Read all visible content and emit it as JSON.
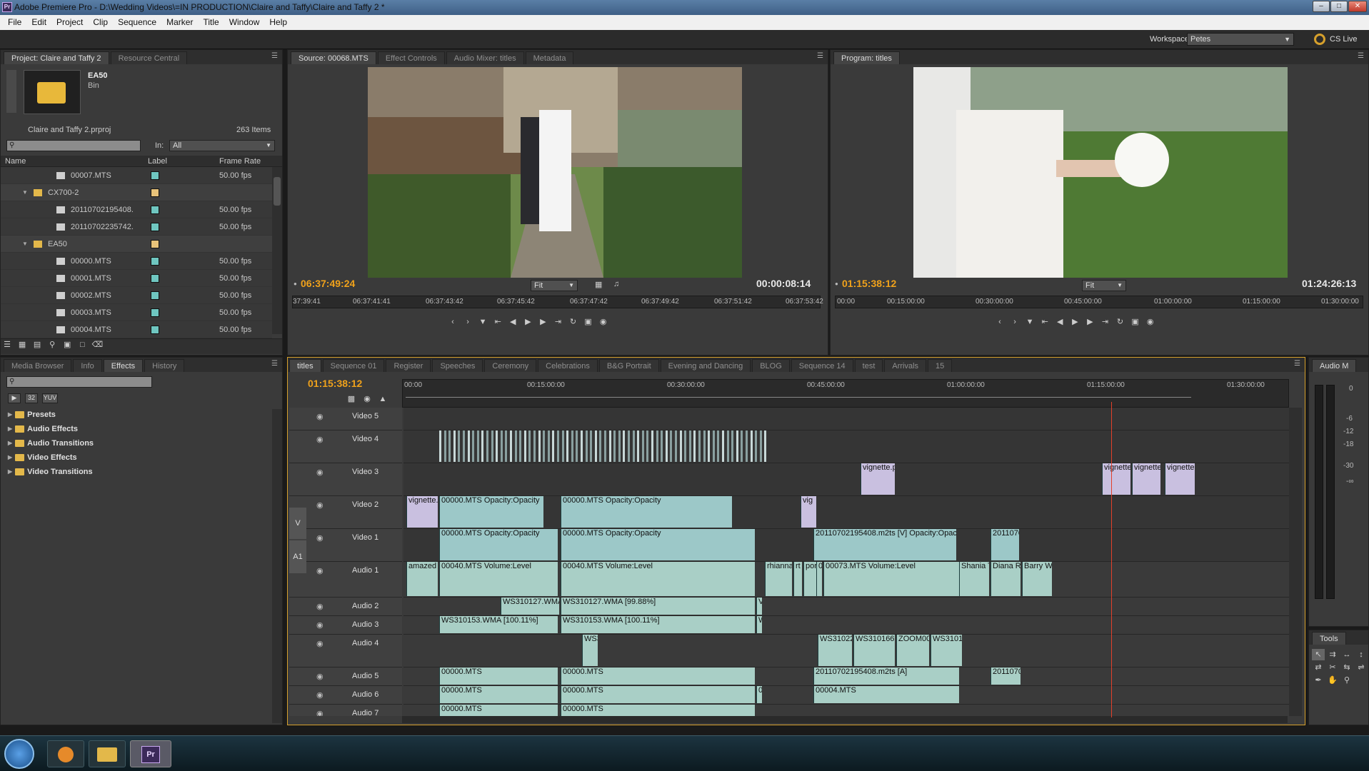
{
  "window": {
    "title": "Adobe Premiere Pro - D:\\Wedding Videos\\=IN PRODUCTION\\Claire and Taffy\\Claire and Taffy 2 *",
    "icon": "Pr"
  },
  "menu": [
    "File",
    "Edit",
    "Project",
    "Clip",
    "Sequence",
    "Marker",
    "Title",
    "Window",
    "Help"
  ],
  "workspace": {
    "label": "Workspace:",
    "value": "Petes",
    "cslive": "CS Live"
  },
  "project_panel": {
    "tabs": [
      "Project: Claire and Taffy 2",
      "Resource Central"
    ],
    "bin_name": "EA50",
    "bin_type": "Bin",
    "project_file": "Claire and Taffy 2.prproj",
    "item_count": "263 Items",
    "in_label": "In:",
    "in_value": "All",
    "columns": [
      "Name",
      "Label",
      "Frame Rate"
    ],
    "rows": [
      {
        "name": "00007.MTS",
        "rate": "50.00 fps",
        "type": "clip",
        "color": "#6fc6c0"
      },
      {
        "name": "CX700-2",
        "rate": "",
        "type": "bin",
        "color": "#e8c37a"
      },
      {
        "name": "20110702195408.",
        "rate": "50.00 fps",
        "type": "clip",
        "color": "#6fc6c0"
      },
      {
        "name": "20110702235742.",
        "rate": "50.00 fps",
        "type": "clip",
        "color": "#6fc6c0"
      },
      {
        "name": "EA50",
        "rate": "",
        "type": "bin",
        "color": "#e8c37a"
      },
      {
        "name": "00000.MTS",
        "rate": "50.00 fps",
        "type": "clip",
        "color": "#6fc6c0"
      },
      {
        "name": "00001.MTS",
        "rate": "50.00 fps",
        "type": "clip",
        "color": "#6fc6c0"
      },
      {
        "name": "00002.MTS",
        "rate": "50.00 fps",
        "type": "clip",
        "color": "#6fc6c0"
      },
      {
        "name": "00003.MTS",
        "rate": "50.00 fps",
        "type": "clip",
        "color": "#6fc6c0"
      },
      {
        "name": "00004.MTS",
        "rate": "50.00 fps",
        "type": "clip",
        "color": "#6fc6c0"
      }
    ]
  },
  "source_monitor": {
    "tabs": [
      "Source: 00068.MTS",
      "Effect Controls",
      "Audio Mixer: titles",
      "Metadata"
    ],
    "timecode_in": "06:37:49:24",
    "duration": "00:00:08:14",
    "fit": "Fit",
    "ruler": [
      "37:39:41",
      "06:37:41:41",
      "06:37:43:42",
      "06:37:45:42",
      "06:37:47:42",
      "06:37:49:42",
      "06:37:51:42",
      "06:37:53:42"
    ]
  },
  "program_monitor": {
    "tabs": [
      "Program: titles"
    ],
    "timecode_in": "01:15:38:12",
    "duration": "01:24:26:13",
    "fit": "Fit",
    "ruler": [
      "00:00",
      "00:15:00:00",
      "00:30:00:00",
      "00:45:00:00",
      "01:00:00:00",
      "01:15:00:00",
      "01:30:00:00"
    ]
  },
  "effects_panel": {
    "tabs": [
      "Media Browser",
      "Info",
      "Effects",
      "History"
    ],
    "buttons": [
      "32",
      "YUV"
    ],
    "folders": [
      "Presets",
      "Audio Effects",
      "Audio Transitions",
      "Video Effects",
      "Video Transitions"
    ]
  },
  "timeline": {
    "tabs": [
      "titles",
      "Sequence 01",
      "Register",
      "Speeches",
      "Ceremony",
      "Celebrations",
      "B&G Portrait",
      "Evening and Dancing",
      "BLOG",
      "Sequence 14",
      "test",
      "Arrivals",
      "15"
    ],
    "timecode": "01:15:38:12",
    "ruler": [
      "00:00",
      "00:15:00:00",
      "00:30:00:00",
      "00:45:00:00",
      "01:00:00:00",
      "01:15:00:00",
      "01:30:00:00"
    ],
    "tracks": [
      "Video 5",
      "Video 4",
      "Video 3",
      "Video 2",
      "Video 1",
      "Audio 1",
      "Audio 2",
      "Audio 3",
      "Audio 4",
      "Audio 5",
      "Audio 6",
      "Audio 7"
    ],
    "v_label": "V",
    "a_label": "A1",
    "clips": {
      "v3": [
        "vignette.ps",
        "vignette.",
        "vignette.",
        "vignette."
      ],
      "v2": [
        "vignette.",
        "00000.MTS  Opacity:Opacity",
        "00000.MTS  Opacity:Opacity",
        "vig"
      ],
      "v1": [
        "00000.MTS  Opacity:Opacity",
        "00000.MTS  Opacity:Opacity",
        "20110702195408.m2ts [V]  Opacity:Opacity",
        "2011070"
      ],
      "a1": [
        "amazed w",
        "00040.MTS  Volume:Level",
        "00040.MTS  Volume:Level",
        "rhianna",
        "rt",
        "por",
        "0",
        "00073.MTS  Volume:Level",
        "Shania T",
        "Diana Ro",
        "Barry Wh"
      ],
      "a2": [
        "WS310127.WMA [9",
        "WS310127.WMA [99.88%]",
        "V"
      ],
      "a3": [
        "WS310153.WMA [100.11%]",
        "WS310153.WMA [100.11%]",
        "W"
      ],
      "a4": [
        "WS3",
        "WS310223",
        "WS310166.W",
        "ZOOM000",
        "WS310154"
      ],
      "a5": [
        "00000.MTS",
        "00000.MTS",
        "20110702195408.m2ts [A]",
        "20110702"
      ],
      "a6": [
        "00000.MTS",
        "00000.MTS",
        "0",
        "00004.MTS"
      ],
      "a7": [
        "00000.MTS",
        "00000.MTS"
      ]
    }
  },
  "audio_meter": {
    "title": "Audio M",
    "scale": [
      "0",
      "-6",
      "-12",
      "-18",
      "-30",
      "-∞"
    ]
  },
  "tools": {
    "title": "Tools"
  },
  "taskbar": {
    "apps": [
      "start-orb",
      "media-player",
      "explorer",
      "Pr"
    ]
  }
}
